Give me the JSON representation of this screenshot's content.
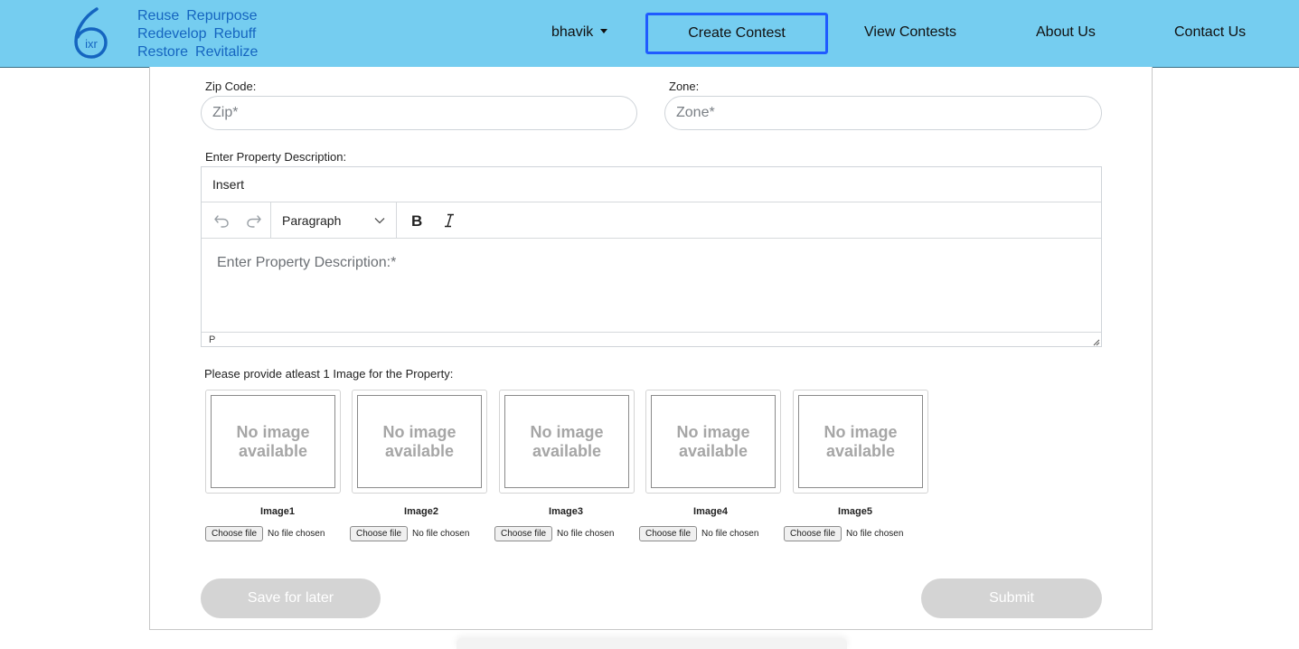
{
  "header": {
    "tagline": [
      [
        "Reuse",
        "Repurpose"
      ],
      [
        "Redevelop",
        "Rebuff"
      ],
      [
        "Restore",
        "Revitalize"
      ]
    ],
    "user_menu": "bhavik",
    "nav": {
      "create": "Create Contest",
      "view": "View Contests",
      "about": "About Us",
      "contact": "Contact Us"
    },
    "colors": {
      "bar": "#75cdf0",
      "tagline": "#1565c0",
      "active_outline": "#1f5bff"
    }
  },
  "form": {
    "zip": {
      "label": "Zip Code:",
      "placeholder": "Zip*"
    },
    "zone": {
      "label": "Zone:",
      "placeholder": "Zone*"
    },
    "description": {
      "label": "Enter Property Description:",
      "menubar": "Insert",
      "format_select": "Paragraph",
      "placeholder": "Enter Property Description:*",
      "status_path": "P"
    },
    "images_label": "Please provide atleast 1 Image for the Property:",
    "images": [
      {
        "placeholder_line1": "No image",
        "placeholder_line2": "available",
        "caption": "Image1",
        "button": "Choose file",
        "status": "No file chosen"
      },
      {
        "placeholder_line1": "No image",
        "placeholder_line2": "available",
        "caption": "Image2",
        "button": "Choose file",
        "status": "No file chosen"
      },
      {
        "placeholder_line1": "No image",
        "placeholder_line2": "available",
        "caption": "Image3",
        "button": "Choose file",
        "status": "No file chosen"
      },
      {
        "placeholder_line1": "No image",
        "placeholder_line2": "available",
        "caption": "Image4",
        "button": "Choose file",
        "status": "No file chosen"
      },
      {
        "placeholder_line1": "No image",
        "placeholder_line2": "available",
        "caption": "Image5",
        "button": "Choose file",
        "status": "No file chosen"
      }
    ],
    "save_label": "Save for later",
    "submit_label": "Submit"
  }
}
